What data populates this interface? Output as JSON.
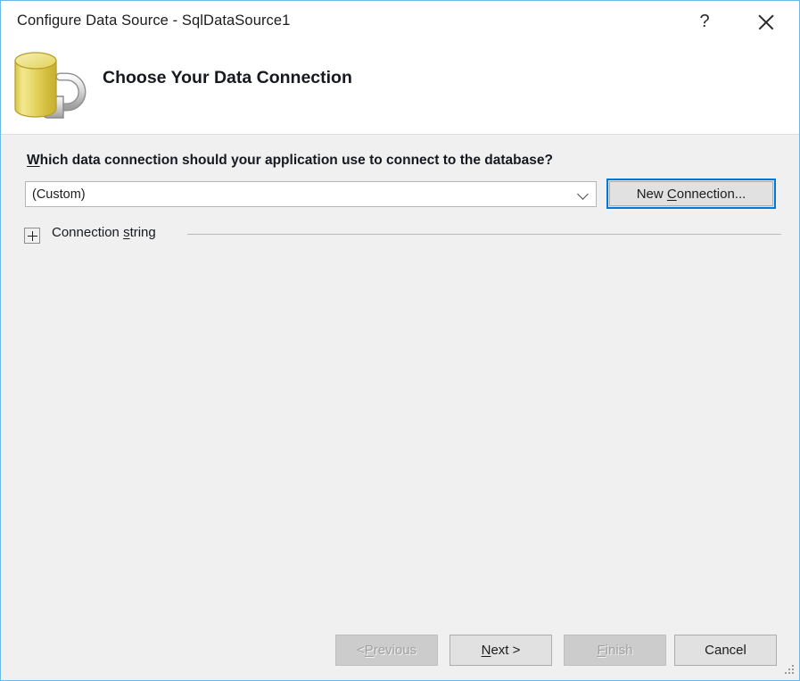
{
  "window": {
    "title": "Configure Data Source - SqlDataSource1",
    "help_label": "?",
    "close_label": "Close",
    "border_color": "#6cb8e8",
    "body_color": "#f0f0f0"
  },
  "header": {
    "title": "Choose Your Data Connection",
    "icon": "database-plug-icon"
  },
  "main": {
    "question_prefix": "W",
    "question_rest": "hich data connection should your application use to connect to the database?",
    "connection_combo": {
      "value": "(Custom)",
      "icon": "chevron-down-icon"
    },
    "new_connection_button": {
      "prefix": "New ",
      "accel": "C",
      "suffix": "onnection...",
      "focus_color": "#0078d7"
    },
    "connection_string_group": {
      "expander_icon": "plus-icon",
      "expanded": false,
      "label_prefix": "Connection ",
      "label_accel": "s",
      "label_suffix": "tring"
    }
  },
  "footer": {
    "buttons": [
      {
        "prefix": "< ",
        "accel": "P",
        "suffix": "revious",
        "enabled": false
      },
      {
        "prefix": "",
        "accel": "N",
        "suffix": "ext >",
        "enabled": true
      },
      {
        "prefix": "",
        "accel": "F",
        "suffix": "inish",
        "enabled": false
      },
      {
        "prefix": "",
        "accel": "",
        "suffix": "Cancel",
        "enabled": true
      }
    ],
    "resize_grip": "resize-grip-icon"
  }
}
